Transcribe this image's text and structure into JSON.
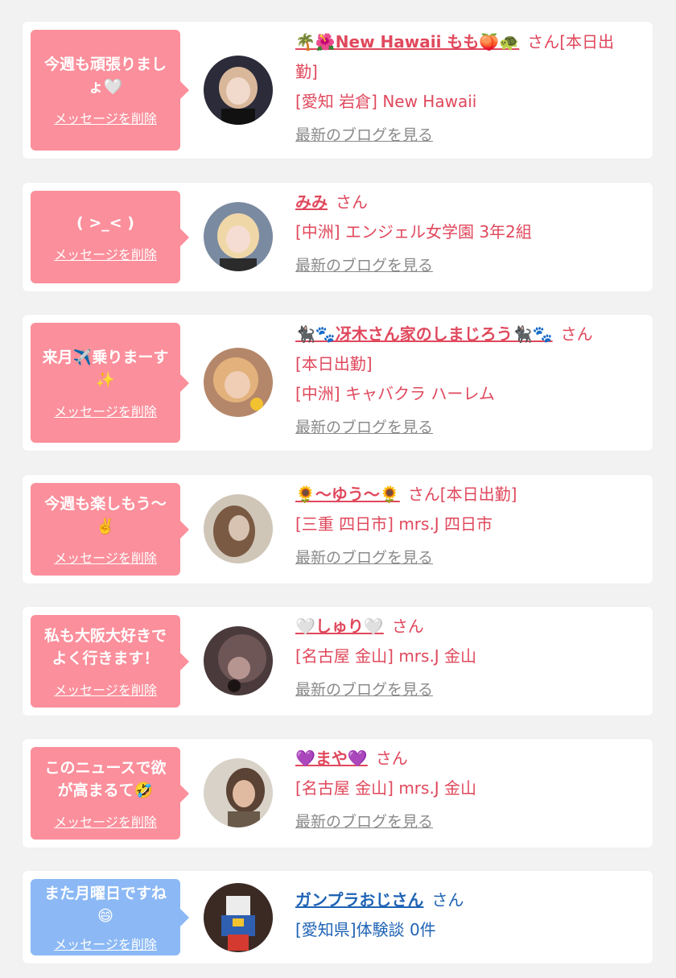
{
  "messages": [
    {
      "text": "今週も頑張りましょ🤍",
      "delete_label": "メッセージを削除",
      "name": "🌴🌺New Hawaii もも🍑🐢",
      "honorific": "さん[本日出",
      "line2": "勤]",
      "line3": "[愛知 岩倉] New Hawaii",
      "blog_label": "最新のブログを見る",
      "avatar": {
        "bg": "#2c2b3a",
        "hair": "#d9b79a",
        "face": "#f1d9cc"
      }
    },
    {
      "text": "( >_< )",
      "delete_label": "メッセージを削除",
      "name": "みみ",
      "honorific": "さん",
      "line2": "[中洲] エンジェル女学園 3年2組",
      "blog_label": "最新のブログを見る",
      "avatar": {
        "bg": "#7a8aa0",
        "hair": "#f0d7a8",
        "face": "#f6ddd3"
      }
    },
    {
      "text": "来月✈️乗りまーす✨",
      "delete_label": "メッセージを削除",
      "name": "🐈‍⬛🐾冴木さん家のしまじろう🐈‍⬛🐾",
      "honorific": "さん",
      "line2": "[本日出勤]",
      "line3": "[中洲] キャバクラ ハーレム",
      "blog_label": "最新のブログを見る",
      "avatar": {
        "bg": "#b5876a",
        "hair": "#e3b27c",
        "face": "#f0cdb5"
      }
    },
    {
      "text": "今週も楽しもう〜✌️",
      "delete_label": "メッセージを削除",
      "name": "🌻〜ゆう〜🌻",
      "honorific": "さん[本日出勤]",
      "line2": "[三重 四日市] mrs.J 四日市",
      "blog_label": "最新のブログを見る",
      "avatar": {
        "bg": "#cfc6b8",
        "hair": "#7a5a43",
        "face": "#d8c3b2"
      }
    },
    {
      "text": "私も大阪大好きでよく行きます！",
      "delete_label": "メッセージを削除",
      "name": "🤍しゅり🤍",
      "honorific": "さん",
      "line2": "[名古屋 金山] mrs.J 金山",
      "blog_label": "最新のブログを見る",
      "avatar": {
        "bg": "#4a3a3c",
        "hair": "#6e5656",
        "face": "#b69591"
      }
    },
    {
      "text": "このニュースで欲が高まるて🤣",
      "delete_label": "メッセージを削除",
      "name": "💜まや💜",
      "honorific": "さん",
      "line2": "[名古屋 金山] mrs.J 金山",
      "blog_label": "最新のブログを見る",
      "avatar": {
        "bg": "#d8d2c8",
        "hair": "#5a4234",
        "face": "#e0bba1"
      }
    },
    {
      "text": "また月曜日ですね😄",
      "delete_label": "メッセージを削除",
      "name": "ガンプラおじさん",
      "honorific": "さん",
      "line2": "[愛知県]体験談 0件",
      "avatar": {
        "bg": "#3b2a24",
        "hair": "#ececec",
        "face": "#2f5fb0"
      }
    }
  ]
}
